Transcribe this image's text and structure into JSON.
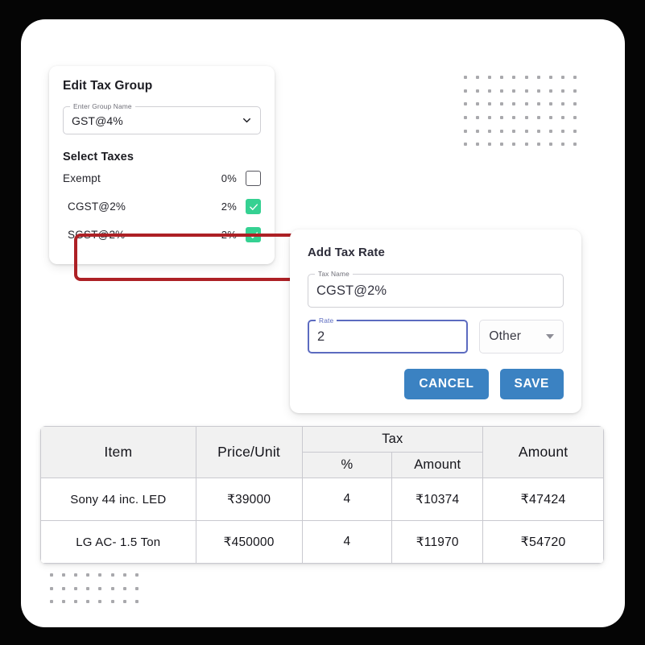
{
  "edit_tax_group": {
    "title": "Edit Tax Group",
    "group_name_field": {
      "label": "Enter Group Name",
      "value": "GST@4%",
      "dropdown_icon": "chevron-down-icon"
    },
    "section_title": "Select Taxes",
    "taxes": [
      {
        "name": "Exempt",
        "rate": "0%",
        "checked": false
      },
      {
        "name": "CGST@2%",
        "rate": "2%",
        "checked": true
      },
      {
        "name": "SGST@2%",
        "rate": "2%",
        "checked": true
      }
    ],
    "highlight_color": "#ad2025",
    "checkbox_checked_color": "#35d192"
  },
  "add_tax_rate_dialog": {
    "title": "Add Tax Rate",
    "tax_name_field": {
      "label": "Tax Name",
      "value": "CGST@2%"
    },
    "rate_field": {
      "label": "Rate",
      "value": "2",
      "focus_color": "#5c6bc0"
    },
    "unit_select": {
      "value": "Other",
      "icon": "triangle-down-icon"
    },
    "cancel_label": "CANCEL",
    "save_label": "SAVE",
    "button_color": "#3b82c2"
  },
  "items_table": {
    "headers": {
      "item": "Item",
      "price_per_unit": "Price/Unit",
      "tax": "Tax",
      "tax_percent": "%",
      "tax_amount": "Amount",
      "amount": "Amount"
    },
    "rows": [
      {
        "item": "Sony 44 inc. LED",
        "price_per_unit": "₹39000",
        "tax_percent": "4",
        "tax_amount": "₹10374",
        "amount": "₹47424"
      },
      {
        "item": "LG AC- 1.5 Ton",
        "price_per_unit": "₹450000",
        "tax_percent": "4",
        "tax_amount": "₹11970",
        "amount": "₹54720"
      }
    ]
  },
  "decorations": {
    "dots_top_right": {
      "cols": 10,
      "rows": 6
    },
    "dots_bottom_left": {
      "cols": 8,
      "rows": 3
    }
  }
}
